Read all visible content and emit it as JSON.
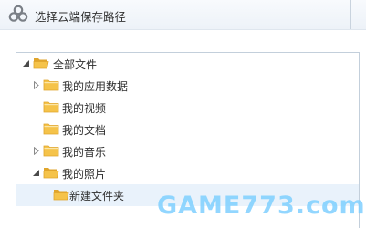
{
  "window": {
    "title": "选择云端保存路径",
    "logo_icon": "baidu-cloud-logo-icon"
  },
  "tree": [
    {
      "label": "全部文件",
      "level": 0,
      "expander": "expanded",
      "folder": "open",
      "selected": false
    },
    {
      "label": "我的应用数据",
      "level": 1,
      "expander": "collapsed",
      "folder": "closed",
      "selected": false
    },
    {
      "label": "我的视频",
      "level": 1,
      "expander": "none",
      "folder": "closed",
      "selected": false
    },
    {
      "label": "我的文档",
      "level": 1,
      "expander": "none",
      "folder": "closed",
      "selected": false
    },
    {
      "label": "我的音乐",
      "level": 1,
      "expander": "collapsed",
      "folder": "closed",
      "selected": false
    },
    {
      "label": "我的照片",
      "level": 1,
      "expander": "expanded",
      "folder": "open",
      "selected": false
    },
    {
      "label": "新建文件夹",
      "level": 2,
      "expander": "none",
      "folder": "open",
      "selected": true
    }
  ],
  "watermark": {
    "text": "GAME773.com"
  },
  "colors": {
    "folder": "#f5c34a",
    "folder_dark": "#e0a52c",
    "selection": "#e9f2fb",
    "arrow": "#4a4a4a",
    "arrow_collapsed": "#8a8a8a"
  }
}
